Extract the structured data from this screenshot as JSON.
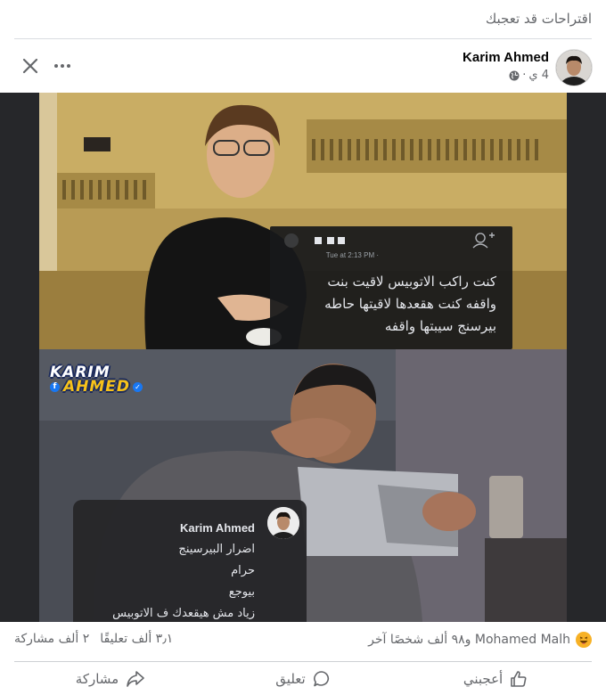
{
  "suggestions": {
    "title": "اقتراحات قد تعجبك"
  },
  "post": {
    "author": "Karim Ahmed",
    "time": "4 ي",
    "more_icon": "more-horizontal-icon",
    "close_icon": "close-icon",
    "privacy_icon": "globe-icon"
  },
  "meme": {
    "screenshot_time": "Tue at 2:13 PM ·",
    "screenshot_text_lines": [
      "كنت راكب الاتوبيس لاقيت بنت",
      "واقفه كنت هقعدها لاقيتها حاطه",
      "بيرسنج سيبتها واقفه"
    ],
    "brand_line1": "KARIM",
    "brand_line2": "AHMED",
    "comment_author": "Karim Ahmed",
    "comment_lines": [
      "اضرار البيرسينج",
      "حرام",
      "بيوجع",
      "زياد مش هيقعدك ف الاتوبيس"
    ]
  },
  "stats": {
    "reactions_text": "Mohamed Malh و٩٨ ألف شخصًا آخر",
    "comments": "٣٫١ ألف تعليقًا",
    "shares": "٢ ألف مشاركة"
  },
  "actions": {
    "like": "أعجبني",
    "comment": "تعليق",
    "share": "مشاركة"
  },
  "colors": {
    "secondary_text": "#65676b",
    "facebook_blue": "#1877f2",
    "haha_yellow": "#f7b125"
  }
}
